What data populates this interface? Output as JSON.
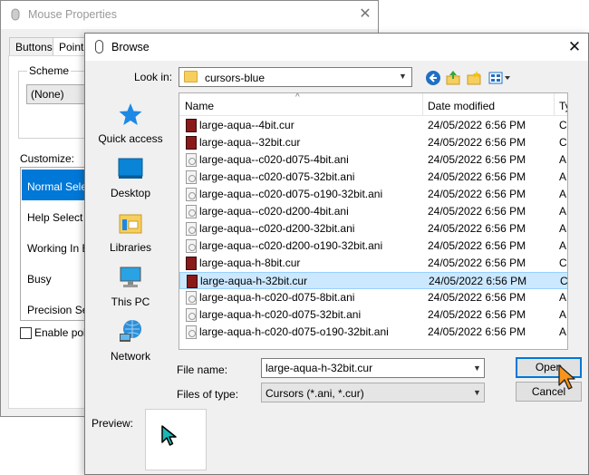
{
  "mouse_window": {
    "title": "Mouse Properties",
    "tabs": [
      "Buttons",
      "Pointe"
    ],
    "scheme_label": "Scheme",
    "scheme_value": "(None)",
    "customize_label": "Customize:",
    "cursor_items": [
      "Normal Select",
      "Help Select",
      "Working In Ba",
      "Busy",
      "Precision Sele"
    ],
    "enable_label": "Enable poin"
  },
  "browse": {
    "title": "Browse",
    "look_in_label": "Look in:",
    "look_in_value": "cursors-blue",
    "places": [
      "Quick access",
      "Desktop",
      "Libraries",
      "This PC",
      "Network"
    ],
    "columns": {
      "name": "Name",
      "date": "Date modified",
      "type": "Ty"
    },
    "files": [
      {
        "name": "large-aqua--4bit.cur",
        "date": "24/05/2022 6:56 PM",
        "type": "CU",
        "kind": "cur"
      },
      {
        "name": "large-aqua--32bit.cur",
        "date": "24/05/2022 6:56 PM",
        "type": "CU",
        "kind": "cur"
      },
      {
        "name": "large-aqua--c020-d075-4bit.ani",
        "date": "24/05/2022 6:56 PM",
        "type": "AN",
        "kind": "ani"
      },
      {
        "name": "large-aqua--c020-d075-32bit.ani",
        "date": "24/05/2022 6:56 PM",
        "type": "AN",
        "kind": "ani"
      },
      {
        "name": "large-aqua--c020-d075-o190-32bit.ani",
        "date": "24/05/2022 6:56 PM",
        "type": "AN",
        "kind": "ani"
      },
      {
        "name": "large-aqua--c020-d200-4bit.ani",
        "date": "24/05/2022 6:56 PM",
        "type": "AN",
        "kind": "ani"
      },
      {
        "name": "large-aqua--c020-d200-32bit.ani",
        "date": "24/05/2022 6:56 PM",
        "type": "AN",
        "kind": "ani"
      },
      {
        "name": "large-aqua--c020-d200-o190-32bit.ani",
        "date": "24/05/2022 6:56 PM",
        "type": "AN",
        "kind": "ani"
      },
      {
        "name": "large-aqua-h-8bit.cur",
        "date": "24/05/2022 6:56 PM",
        "type": "CU",
        "kind": "cur"
      },
      {
        "name": "large-aqua-h-32bit.cur",
        "date": "24/05/2022 6:56 PM",
        "type": "CU",
        "kind": "cur",
        "selected": true
      },
      {
        "name": "large-aqua-h-c020-d075-8bit.ani",
        "date": "24/05/2022 6:56 PM",
        "type": "AN",
        "kind": "ani"
      },
      {
        "name": "large-aqua-h-c020-d075-32bit.ani",
        "date": "24/05/2022 6:56 PM",
        "type": "AN",
        "kind": "ani"
      },
      {
        "name": "large-aqua-h-c020-d075-o190-32bit.ani",
        "date": "24/05/2022 6:56 PM",
        "type": "AN",
        "kind": "ani"
      }
    ],
    "file_name_label": "File name:",
    "file_name_value": "large-aqua-h-32bit.cur",
    "files_of_type_label": "Files of type:",
    "files_of_type_value": "Cursors (*.ani, *.cur)",
    "open_label": "Open",
    "cancel_label": "Cancel",
    "preview_label": "Preview:"
  },
  "colors": {
    "accent": "#0078d7",
    "selection": "#cce8ff",
    "folder": "#f6cf5e"
  }
}
